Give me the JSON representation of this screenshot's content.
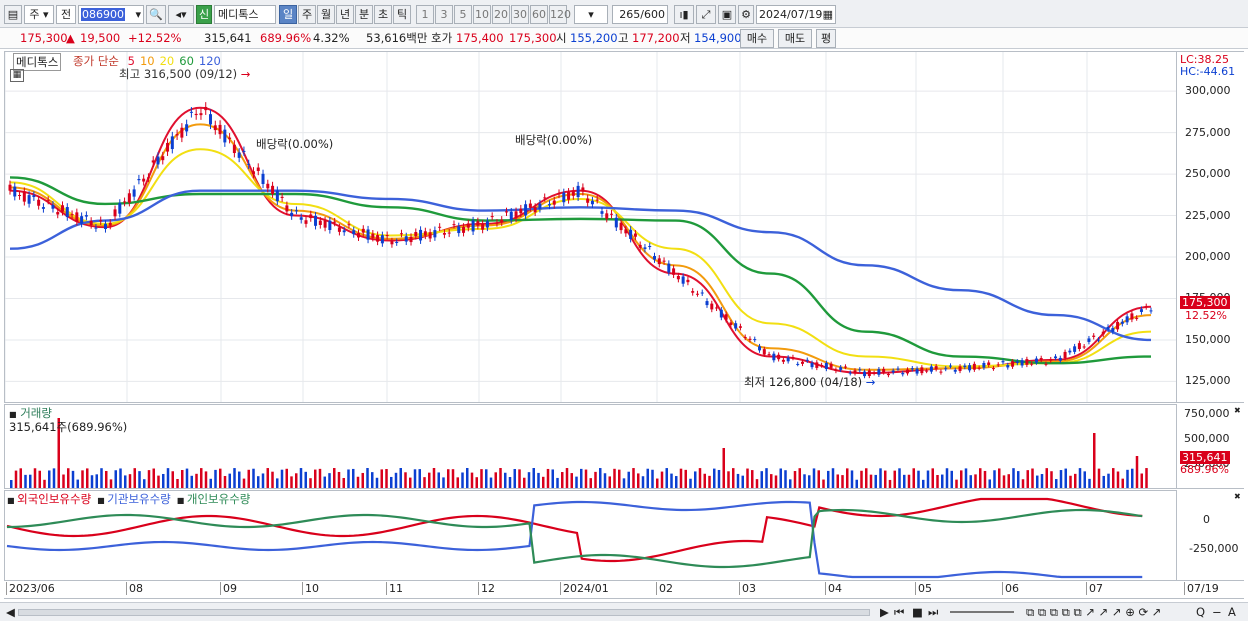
{
  "toolbar": {
    "market_type": "주",
    "scope": "전",
    "code": "086900",
    "new_badge": "신",
    "stock_name": "메디톡스",
    "periods": [
      "일",
      "주",
      "월",
      "년",
      "분",
      "초",
      "틱"
    ],
    "intervals": [
      "1",
      "3",
      "5",
      "10",
      "20",
      "30",
      "60",
      "120"
    ],
    "count": "265",
    "count_total": "/600",
    "date": "2024/07/19"
  },
  "quote": {
    "price": "175,300",
    "change": "19,500",
    "change_pct": "+12.52%",
    "volume": "315,641",
    "volume_ratio": "689.96%",
    "turnover": "4.32%",
    "amount": "53,616백만",
    "ask_label": "호가",
    "ask": "175,400",
    "bid": "175,300",
    "open_label": "시",
    "open": "155,200",
    "high_label": "고",
    "high": "177,200",
    "low_label": "저",
    "low": "154,900",
    "buy_label": "매수",
    "sell_label": "매도",
    "fix_label": "평"
  },
  "price_pane": {
    "title": "메디톡스",
    "legend_prefix": "종가 단순",
    "ma": [
      {
        "period": "5",
        "color": "#e0102f"
      },
      {
        "period": "10",
        "color": "#f29b0d"
      },
      {
        "period": "20",
        "color": "#f2df12"
      },
      {
        "period": "60",
        "color": "#1f9a3b"
      },
      {
        "period": "120",
        "color": "#3c61da"
      }
    ],
    "high_note": "최고 316,500 (09/12)",
    "low_note": "최저 126,800 (04/18)",
    "dividend1": "배당락(0.00%)",
    "dividend2": "배당락(0.00%)",
    "lc": "LC:38.25",
    "hc": "HC:-44.61",
    "y_ticks": [
      "300,000",
      "275,000",
      "250,000",
      "225,000",
      "200,000",
      "175,000",
      "150,000",
      "125,000"
    ],
    "y_values": [
      300000,
      275000,
      250000,
      225000,
      200000,
      175000,
      150000,
      125000
    ],
    "last_price": "175,300",
    "last_pct": "12.52%"
  },
  "volume_pane": {
    "title": "거래량",
    "value": "315,641주(689.96%)",
    "y_ticks": [
      "750,000",
      "500,000",
      "250,000"
    ],
    "last": "315,641",
    "last_pct": "689.96%"
  },
  "holding_pane": {
    "series": [
      {
        "name": "외국인보유수량",
        "color": "#d9001b"
      },
      {
        "name": "기관보유수량",
        "color": "#3c61da"
      },
      {
        "name": "개인보유수량",
        "color": "#2e8b57"
      }
    ],
    "y_ticks": [
      "0",
      "-250,000"
    ]
  },
  "x_axis": [
    "2023/06",
    "08",
    "09",
    "10",
    "11",
    "12",
    "2024/01",
    "02",
    "03",
    "04",
    "05",
    "06",
    "07",
    "07/19"
  ],
  "colors": {
    "up": "#d9001b",
    "down": "#0b3fd1",
    "ma5": "#e0102f",
    "ma10": "#f29b0d",
    "ma20": "#f2df12",
    "ma60": "#1f9a3b",
    "ma120": "#3c61da"
  },
  "chart_data": {
    "type": "line",
    "title": "메디톡스",
    "ylim": [
      115000,
      320000
    ],
    "x": [
      "2023/06",
      "08",
      "09",
      "10",
      "11",
      "12",
      "2024/01",
      "02",
      "03",
      "04",
      "05",
      "06",
      "07"
    ],
    "series": [
      {
        "name": "5",
        "values": [
          240000,
          218000,
          290000,
          225000,
          210000,
          220000,
          240000,
          190000,
          140000,
          130000,
          133000,
          138000,
          170000
        ]
      },
      {
        "name": "10",
        "values": [
          242000,
          219000,
          280000,
          228000,
          211000,
          219000,
          238000,
          195000,
          145000,
          132000,
          133000,
          137000,
          165000
        ]
      },
      {
        "name": "20",
        "values": [
          245000,
          220000,
          265000,
          232000,
          213000,
          217000,
          235000,
          205000,
          160000,
          140000,
          134000,
          136000,
          155000
        ]
      },
      {
        "name": "60",
        "values": [
          248000,
          232000,
          238000,
          238000,
          230000,
          222000,
          223000,
          222000,
          190000,
          155000,
          140000,
          136000,
          140000
        ]
      },
      {
        "name": "120",
        "values": [
          205000,
          222000,
          240000,
          240000,
          235000,
          228000,
          230000,
          228000,
          215000,
          195000,
          180000,
          165000,
          150000
        ]
      }
    ]
  }
}
